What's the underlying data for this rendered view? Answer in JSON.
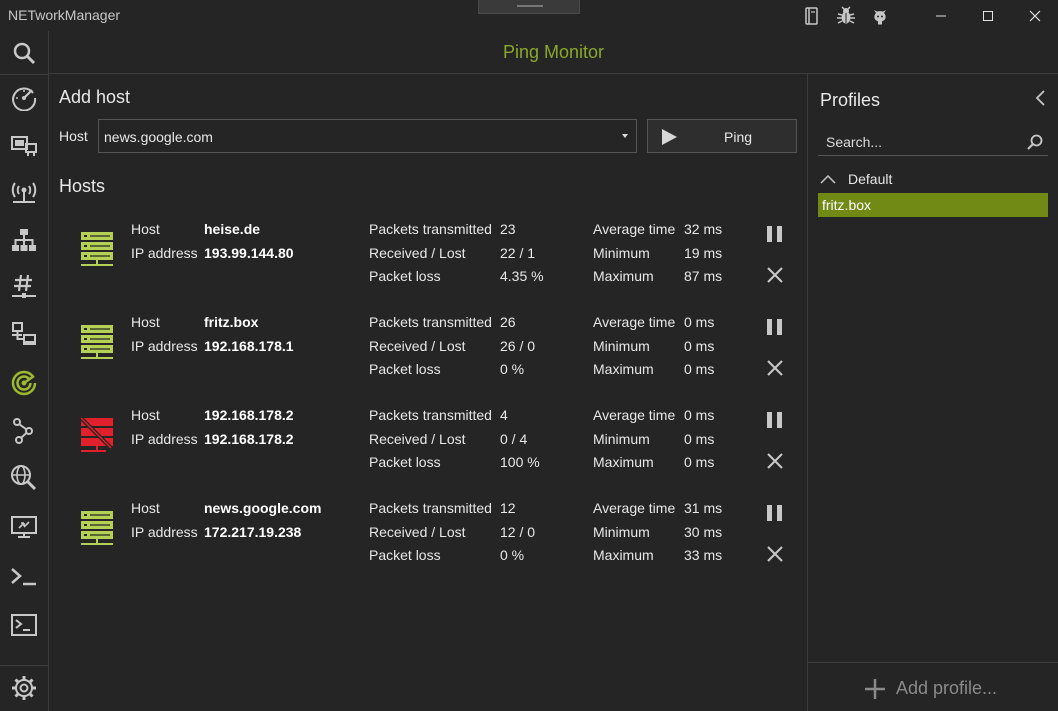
{
  "app": {
    "title": "NETworkManager"
  },
  "titlebar": {
    "icons": [
      "documentation-icon",
      "bug-icon",
      "github-icon"
    ],
    "window_buttons": [
      "minimize",
      "maximize",
      "close"
    ]
  },
  "sidebar": {
    "items": [
      {
        "name": "search",
        "icon": "search-icon"
      },
      {
        "name": "dashboard",
        "icon": "speedometer-icon"
      },
      {
        "name": "network-interface",
        "icon": "network-interface-icon"
      },
      {
        "name": "wifi",
        "icon": "wifi-icon"
      },
      {
        "name": "ip-scanner",
        "icon": "sitemap-icon"
      },
      {
        "name": "port-scanner",
        "icon": "hashtag-icon"
      },
      {
        "name": "remote-desktop",
        "icon": "lan-icon"
      },
      {
        "name": "ping-monitor",
        "icon": "radar-icon",
        "active": true
      },
      {
        "name": "traceroute",
        "icon": "route-icon"
      },
      {
        "name": "dns-lookup",
        "icon": "web-search-icon"
      },
      {
        "name": "remote-desktop-2",
        "icon": "monitor-icon"
      },
      {
        "name": "powershell",
        "icon": "console-icon"
      },
      {
        "name": "putty",
        "icon": "terminal-icon"
      },
      {
        "name": "settings",
        "icon": "gear-icon"
      }
    ]
  },
  "header": {
    "title": "Ping Monitor"
  },
  "add_host": {
    "title": "Add host",
    "host_label": "Host",
    "host_value": "news.google.com",
    "ping_label": "Ping"
  },
  "hosts_title": "Hosts",
  "labels": {
    "host": "Host",
    "ip_address": "IP address",
    "packets_transmitted": "Packets transmitted",
    "received_lost": "Received / Lost",
    "packet_loss": "Packet loss",
    "average_time": "Average time",
    "minimum": "Minimum",
    "maximum": "Maximum"
  },
  "hosts": [
    {
      "host": "heise.de",
      "ip": "193.99.144.80",
      "transmitted": "23",
      "received_lost": "22 / 1",
      "loss": "4.35 %",
      "avg": "32 ms",
      "min": "19 ms",
      "max": "87 ms",
      "status": "up"
    },
    {
      "host": "fritz.box",
      "ip": "192.168.178.1",
      "transmitted": "26",
      "received_lost": "26 / 0",
      "loss": "0 %",
      "avg": "0 ms",
      "min": "0 ms",
      "max": "0 ms",
      "status": "up"
    },
    {
      "host": "192.168.178.2",
      "ip": "192.168.178.2",
      "transmitted": "4",
      "received_lost": "0 / 4",
      "loss": "100 %",
      "avg": "0 ms",
      "min": "0 ms",
      "max": "0 ms",
      "status": "down"
    },
    {
      "host": "news.google.com",
      "ip": "172.217.19.238",
      "transmitted": "12",
      "received_lost": "12 / 0",
      "loss": "0 %",
      "avg": "31 ms",
      "min": "30 ms",
      "max": "33 ms",
      "status": "up"
    }
  ],
  "profiles": {
    "title": "Profiles",
    "search_placeholder": "Search...",
    "group": "Default",
    "items": [
      "fritz.box"
    ],
    "add_label": "Add profile..."
  },
  "colors": {
    "accent": "#8aa827",
    "up": "#b4d155",
    "down": "#e0202a",
    "selected": "#718a16"
  }
}
